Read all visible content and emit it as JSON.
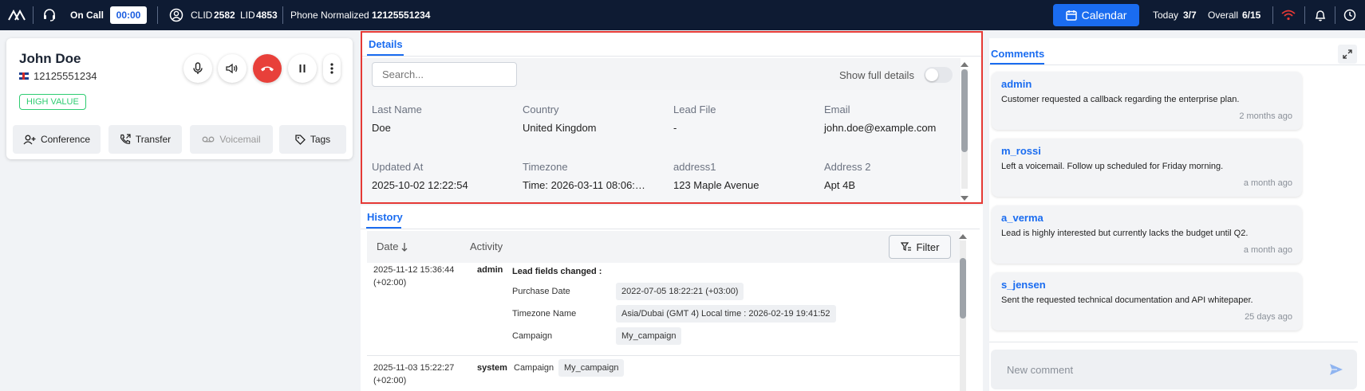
{
  "topbar": {
    "status": "On Call",
    "timer": "00:00",
    "clid_label": "CLID",
    "clid_value": "2582",
    "lid_label": "LID",
    "lid_value": "4853",
    "phone_label": "Phone Normalized",
    "phone_value": "12125551234",
    "calendar_label": "Calendar",
    "today_label": "Today",
    "today_value": "3/7",
    "overall_label": "Overall",
    "overall_value": "6/15"
  },
  "call": {
    "name": "John Doe",
    "phone": "12125551234",
    "badge": "HIGH VALUE",
    "actions": {
      "conference": "Conference",
      "transfer": "Transfer",
      "voicemail": "Voicemail",
      "tags": "Tags"
    }
  },
  "details": {
    "tab": "Details",
    "search_placeholder": "Search...",
    "toggle_label": "Show full details",
    "fields": [
      {
        "label": "Last Name",
        "value": "Doe"
      },
      {
        "label": "Country",
        "value": "United Kingdom"
      },
      {
        "label": "Lead File",
        "value": "-"
      },
      {
        "label": "Email",
        "value": "john.doe@example.com"
      },
      {
        "label": "Updated At",
        "value": "2025-10-02 12:22:54"
      },
      {
        "label": "Timezone",
        "value": "Time: 2026-03-11 08:06:…"
      },
      {
        "label": "address1",
        "value": "123 Maple Avenue"
      },
      {
        "label": "Address 2",
        "value": "Apt 4B"
      }
    ]
  },
  "history": {
    "tab": "History",
    "col_date": "Date",
    "col_activity": "Activity",
    "filter_label": "Filter",
    "entries": [
      {
        "date": "2025-11-12 15:36:44",
        "tz": "(+02:00)",
        "user": "admin",
        "title": "Lead fields changed :",
        "changes": [
          {
            "field": "Purchase Date",
            "value": "2022-07-05 18:22:21 (+03:00)"
          },
          {
            "field": "Timezone Name",
            "value": "Asia/Dubai (GMT 4) Local time : 2026-02-19 19:41:52"
          },
          {
            "field": "Campaign",
            "value": "My_campaign"
          }
        ]
      },
      {
        "date": "2025-11-03 15:22:27",
        "tz": "(+02:00)",
        "user": "system",
        "field": "Campaign",
        "value": "My_campaign"
      }
    ]
  },
  "comments": {
    "tab": "Comments",
    "items": [
      {
        "author": "admin",
        "text": "Customer requested a callback regarding the enterprise plan.",
        "time": "2 months ago"
      },
      {
        "author": "m_rossi",
        "text": "Left a voicemail. Follow up scheduled for Friday morning.",
        "time": "a month ago"
      },
      {
        "author": "a_verma",
        "text": "Lead is highly interested but currently lacks the budget until Q2.",
        "time": "a month ago"
      },
      {
        "author": "s_jensen",
        "text": "Sent the requested technical documentation and API whitepaper.",
        "time": "25 days ago"
      }
    ],
    "new_placeholder": "New comment"
  },
  "colors": {
    "topbar_bg": "#0e1b33",
    "accent": "#1a6cf0",
    "hangup": "#e8403a",
    "high_value": "#2ecc71",
    "highlight_border": "#e53935"
  }
}
